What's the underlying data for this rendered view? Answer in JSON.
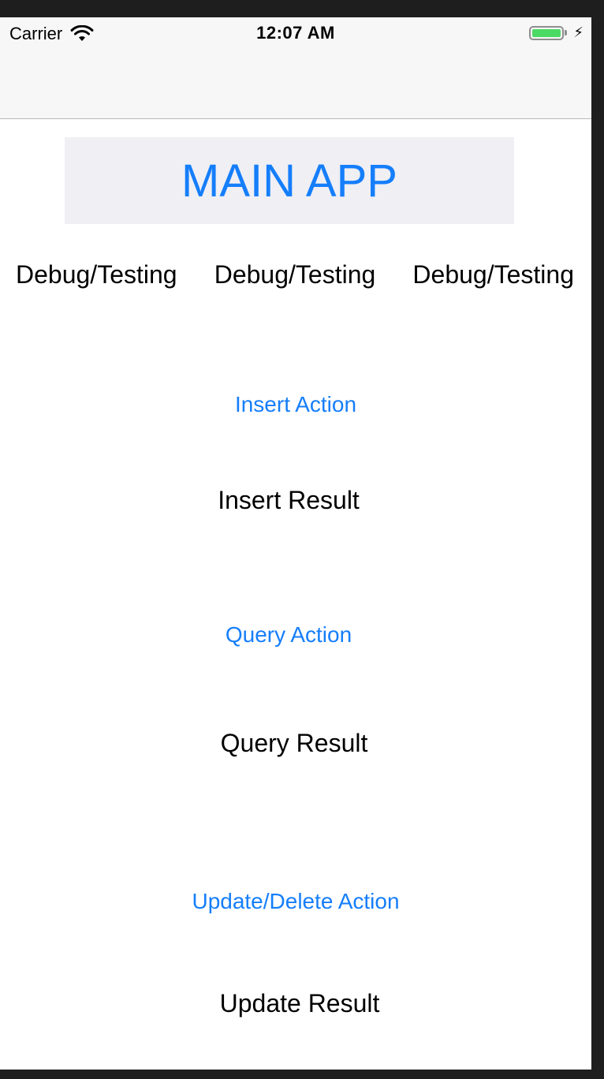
{
  "status_bar": {
    "carrier": "Carrier",
    "time": "12:07 AM",
    "wifi_icon": "wifi-icon",
    "battery_icon": "battery-icon",
    "charging_icon": "charging-bolt-icon",
    "battery_level": 1.0,
    "battery_color": "#4cd964"
  },
  "main_app_button": {
    "label": "MAIN APP",
    "color": "#157efb",
    "background": "#efeff4"
  },
  "debug_labels": [
    "Debug/Testing",
    "Debug/Testing",
    "Debug/Testing"
  ],
  "sections": {
    "insert": {
      "action_label": "Insert Action",
      "result_label": "Insert Result"
    },
    "query": {
      "action_label": "Query Action",
      "result_label": "Query Result"
    },
    "update_delete": {
      "action_label": "Update/Delete Action",
      "result_label": "Update Result"
    }
  },
  "colors": {
    "accent": "#157efb",
    "nav_background": "#f7f7f7",
    "frame": "#1e1e1e"
  }
}
